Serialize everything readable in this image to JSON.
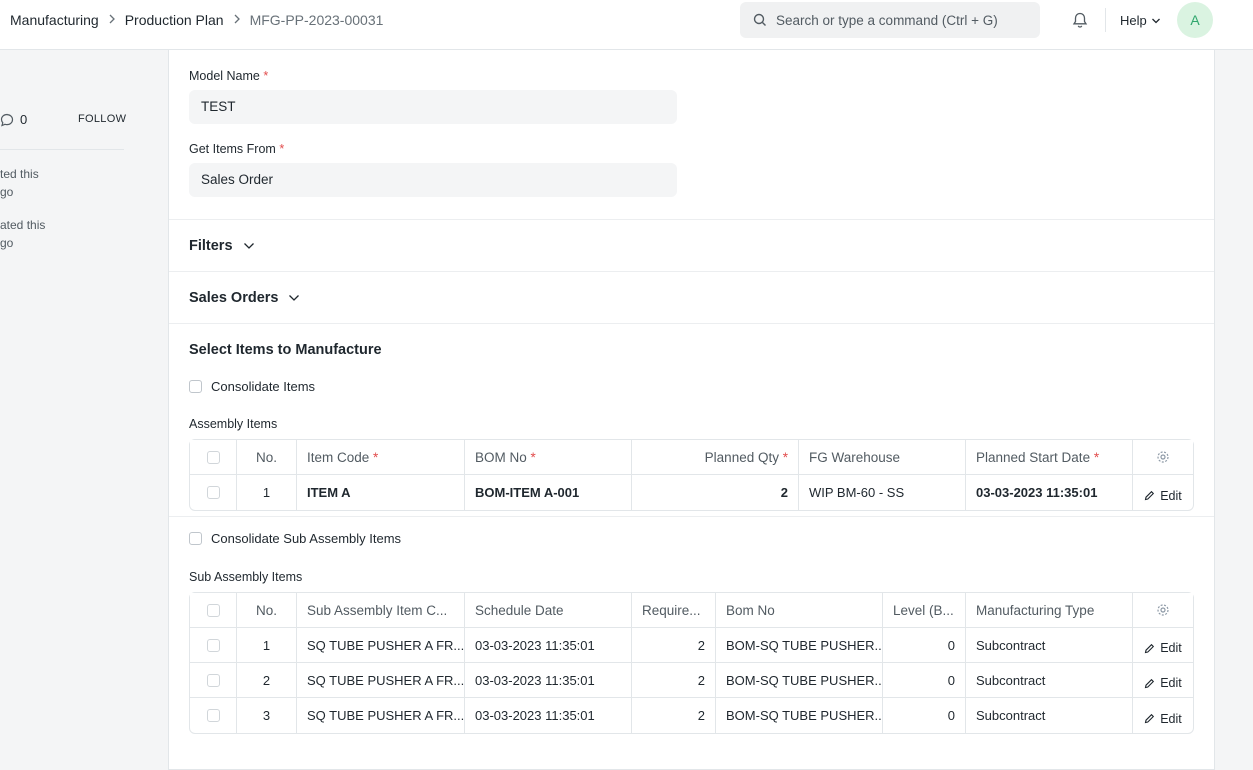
{
  "breadcrumb": {
    "module": "Manufacturing",
    "doctype": "Production Plan",
    "doc": "MFG-PP-2023-00031"
  },
  "search": {
    "placeholder": "Search or type a command (Ctrl + G)"
  },
  "nav": {
    "help": "Help",
    "avatar": "A"
  },
  "sidebar": {
    "comment_count": "0",
    "follow": "FOLLOW",
    "activity": [
      {
        "line1": "ted this",
        "line2": "go"
      },
      {
        "line1": "ated this",
        "line2": "go"
      }
    ]
  },
  "form": {
    "model_name": {
      "label": "Model Name",
      "req": "*",
      "value": "TEST"
    },
    "get_items_from": {
      "label": "Get Items From",
      "req": "*",
      "value": "Sales Order"
    },
    "filters": "Filters",
    "sales_orders": "Sales Orders",
    "select_items": "Select Items to Manufacture",
    "consolidate_items": "Consolidate Items",
    "assembly_items_label": "Assembly Items",
    "consolidate_sub": "Consolidate Sub Assembly Items",
    "sub_assembly_label": "Sub Assembly Items"
  },
  "assembly_table": {
    "headers": {
      "no": "No.",
      "item_code": "Item Code",
      "bom_no": "BOM No",
      "planned_qty": "Planned Qty",
      "fg_warehouse": "FG Warehouse",
      "planned_start": "Planned Start Date",
      "req": "*"
    },
    "rows": [
      {
        "no": "1",
        "item_code": "ITEM A",
        "bom_no": "BOM-ITEM A-001",
        "planned_qty": "2",
        "fg_warehouse": "WIP BM-60 - SS",
        "planned_start": "03-03-2023 11:35:01",
        "edit": "Edit"
      }
    ]
  },
  "sub_table": {
    "headers": {
      "no": "No.",
      "item": "Sub Assembly Item C...",
      "schedule": "Schedule Date",
      "required": "Require...",
      "bom": "Bom No",
      "level": "Level (B...",
      "mtype": "Manufacturing Type"
    },
    "rows": [
      {
        "no": "1",
        "item": "SQ TUBE PUSHER A FR...",
        "schedule": "03-03-2023 11:35:01",
        "required": "2",
        "bom": "BOM-SQ TUBE PUSHER...",
        "level": "0",
        "mtype": "Subcontract",
        "edit": "Edit"
      },
      {
        "no": "2",
        "item": "SQ TUBE PUSHER A FR...",
        "schedule": "03-03-2023 11:35:01",
        "required": "2",
        "bom": "BOM-SQ TUBE PUSHER...",
        "level": "0",
        "mtype": "Subcontract",
        "edit": "Edit"
      },
      {
        "no": "3",
        "item": "SQ TUBE PUSHER A FR...",
        "schedule": "03-03-2023 11:35:01",
        "required": "2",
        "bom": "BOM-SQ TUBE PUSHER...",
        "level": "0",
        "mtype": "Subcontract",
        "edit": "Edit"
      }
    ]
  }
}
